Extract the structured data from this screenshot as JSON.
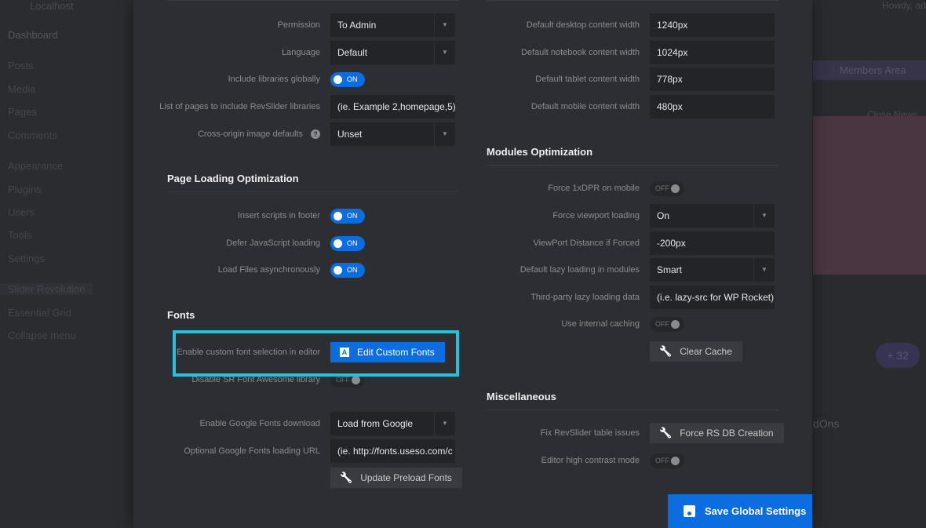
{
  "background": {
    "topbar": {
      "site": "Localhost",
      "howdy": "Howdy, ad"
    },
    "menu": [
      "Dashboard",
      "Posts",
      "Media",
      "Pages",
      "Comments",
      "Appearance",
      "Plugins",
      "Users",
      "Tools",
      "Settings",
      "Slider Revolution",
      "Essential Grid",
      "Collapse menu"
    ],
    "members_area": "Members Area",
    "close_news": "Close News",
    "count_badge": "+ 32",
    "addons_partial": "dOns"
  },
  "left": {
    "general_rows": [
      {
        "label": "Permission",
        "type": "select",
        "value": "To Admin"
      },
      {
        "label": "Language",
        "type": "select",
        "value": "Default"
      },
      {
        "label": "Include libraries globally",
        "type": "toggle",
        "value": "ON"
      },
      {
        "label": "List of pages to include RevSlider libraries",
        "type": "input",
        "value": "(ie. Example 2,homepage,5)"
      },
      {
        "label": "Cross-origin image defaults",
        "type": "select",
        "value": "Unset",
        "help": "?"
      }
    ],
    "page_loading": {
      "title": "Page Loading Optimization",
      "rows": [
        {
          "label": "Insert scripts in footer",
          "type": "toggle",
          "value": "ON"
        },
        {
          "label": "Defer JavaScript loading",
          "type": "toggle",
          "value": "ON"
        },
        {
          "label": "Load Files asynchronously",
          "type": "toggle",
          "value": "ON"
        }
      ]
    },
    "fonts": {
      "title": "Fonts",
      "rows": [
        {
          "label": "Enable custom font selection in editor",
          "type": "button",
          "value": "Edit Custom Fonts",
          "icon": "A",
          "primary": true
        },
        {
          "label": "Disable SR Font Awesome library",
          "type": "toggle",
          "value": "OFF"
        },
        {
          "label": "Enable Google Fonts download",
          "type": "select",
          "value": "Load from Google"
        },
        {
          "label": "Optional Google Fonts loading URL",
          "type": "input",
          "value": "(ie. http://fonts.useso.com/c"
        },
        {
          "label": "",
          "type": "button",
          "value": "Update Preload Fonts",
          "icon": "wrench"
        }
      ]
    }
  },
  "right": {
    "width_rows": [
      {
        "label": "Default desktop content width",
        "type": "input",
        "value": "1240px"
      },
      {
        "label": "Default notebook content width",
        "type": "input",
        "value": "1024px"
      },
      {
        "label": "Default tablet content width",
        "type": "input",
        "value": "778px"
      },
      {
        "label": "Default mobile content width",
        "type": "input",
        "value": "480px"
      }
    ],
    "modules": {
      "title": "Modules Optimization",
      "rows": [
        {
          "label": "Force 1xDPR on mobile",
          "type": "toggle",
          "value": "OFF"
        },
        {
          "label": "Force viewport loading",
          "type": "select",
          "value": "On"
        },
        {
          "label": "ViewPort Distance if Forced",
          "type": "input",
          "value": "-200px"
        },
        {
          "label": "Default lazy loading in modules",
          "type": "select",
          "value": "Smart"
        },
        {
          "label": "Third-party lazy loading data",
          "type": "input",
          "value": "(i.e. lazy-src for WP Rocket)"
        },
        {
          "label": "Use internal caching",
          "type": "toggle",
          "value": "OFF"
        },
        {
          "label": "",
          "type": "button",
          "value": "Clear Cache",
          "icon": "wrench"
        }
      ]
    },
    "misc": {
      "title": "Miscellaneous",
      "rows": [
        {
          "label": "Fix RevSlider table issues",
          "type": "button",
          "value": "Force RS DB Creation",
          "icon": "wrench"
        },
        {
          "label": "Editor high contrast mode",
          "type": "toggle",
          "value": "OFF"
        }
      ]
    }
  },
  "save_button": {
    "label": "Save Global Settings",
    "icon": "floppy-disk"
  },
  "colors": {
    "accent": "#0c6de0",
    "highlight": "#28c1dc",
    "modal_bg": "#2d2e33"
  }
}
